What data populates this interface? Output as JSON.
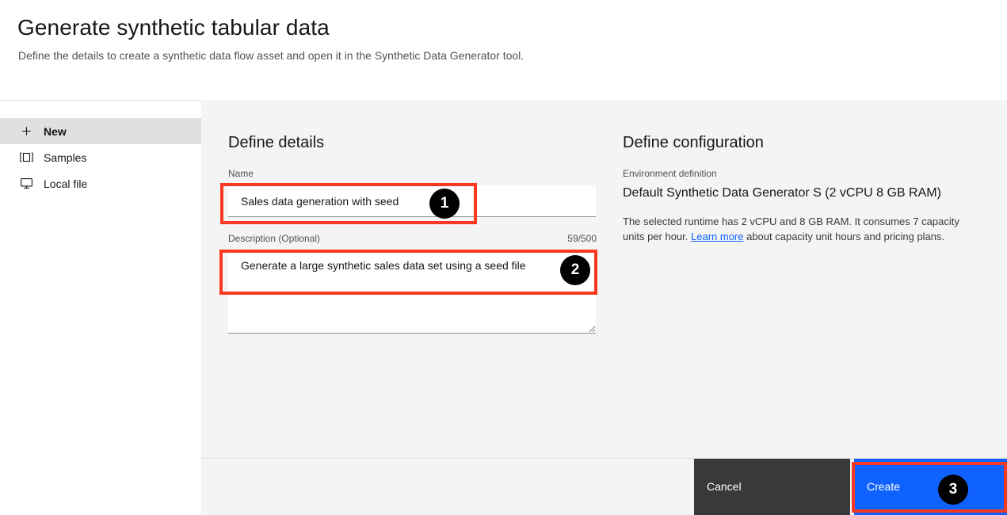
{
  "header": {
    "title": "Generate synthetic tabular data",
    "subtitle": "Define the details to create a synthetic data flow asset and open it in the Synthetic Data Generator tool."
  },
  "sidebar": {
    "items": [
      {
        "label": "New",
        "icon": "plus-icon",
        "selected": true
      },
      {
        "label": "Samples",
        "icon": "samples-icon",
        "selected": false
      },
      {
        "label": "Local file",
        "icon": "monitor-icon",
        "selected": false
      }
    ]
  },
  "details": {
    "heading": "Define details",
    "name_label": "Name",
    "name_value": "Sales data generation with seed",
    "name_placeholder": "",
    "description_label": "Description (Optional)",
    "description_counter": "59/500",
    "description_value": "Generate a large synthetic sales data set using a seed file",
    "description_placeholder": ""
  },
  "configuration": {
    "heading": "Define configuration",
    "environment_label": "Environment definition",
    "environment_value": "Default Synthetic Data Generator S (2 vCPU 8 GB RAM)",
    "description_before_link": "The selected runtime has 2 vCPU and 8 GB RAM. It consumes 7 capacity units per hour. ",
    "link_text": "Learn more",
    "description_after_link": " about capacity unit hours and pricing plans."
  },
  "footer": {
    "cancel_label": "Cancel",
    "create_label": "Create"
  },
  "annotations": {
    "badge_1": "1",
    "badge_2": "2",
    "badge_3": "3",
    "highlight_color": "#f93822",
    "badge_color": "#000000"
  },
  "colors": {
    "accent_blue": "#0f62fe",
    "panel_background": "#f4f4f4",
    "selected_item": "#e0e0e0",
    "cancel_button": "#393939"
  }
}
